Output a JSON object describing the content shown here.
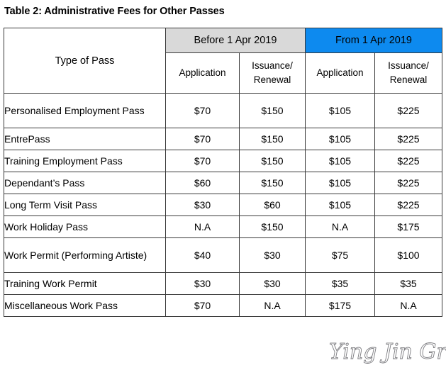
{
  "caption": "Table 2: Administrative Fees for Other Passes",
  "watermark": {
    "text": "Ying Jin Group"
  },
  "table": {
    "header": {
      "type_of_pass": "Type of Pass",
      "groups": [
        {
          "label": "Before 1 Apr 2019",
          "color": "#d9d9d9"
        },
        {
          "label": "From 1 Apr 2019",
          "color": "#0d8aef"
        }
      ],
      "subheaders": [
        "Application",
        "Issuance/ Renewal",
        "Application",
        "Issuance/ Renewal"
      ],
      "subheaders_split": [
        {
          "line1": "Application",
          "line2": ""
        },
        {
          "line1": "Issuance/",
          "line2": "Renewal"
        },
        {
          "line1": "Application",
          "line2": ""
        },
        {
          "line1": "Issuance/",
          "line2": "Renewal"
        }
      ]
    },
    "rows": [
      {
        "pass": "Personalised Employment Pass",
        "before_application": "$70",
        "before_issuance_renewal": "$150",
        "from_application": "$105",
        "from_issuance_renewal": "$225"
      },
      {
        "pass": "EntrePass",
        "before_application": "$70",
        "before_issuance_renewal": "$150",
        "from_application": "$105",
        "from_issuance_renewal": "$225"
      },
      {
        "pass": "Training Employment Pass",
        "before_application": "$70",
        "before_issuance_renewal": "$150",
        "from_application": "$105",
        "from_issuance_renewal": "$225"
      },
      {
        "pass": "Dependant’s Pass",
        "before_application": "$60",
        "before_issuance_renewal": "$150",
        "from_application": "$105",
        "from_issuance_renewal": "$225"
      },
      {
        "pass": "Long Term Visit Pass",
        "before_application": "$30",
        "before_issuance_renewal": "$60",
        "from_application": "$105",
        "from_issuance_renewal": "$225"
      },
      {
        "pass": "Work Holiday Pass",
        "before_application": "N.A",
        "before_issuance_renewal": "$150",
        "from_application": "N.A",
        "from_issuance_renewal": "$175"
      },
      {
        "pass": "Work Permit (Performing Artiste)",
        "before_application": "$40",
        "before_issuance_renewal": "$30",
        "from_application": "$75",
        "from_issuance_renewal": "$100"
      },
      {
        "pass": "Training Work Permit",
        "before_application": "$30",
        "before_issuance_renewal": "$30",
        "from_application": "$35",
        "from_issuance_renewal": "$35"
      },
      {
        "pass": "Miscellaneous Work Pass",
        "before_application": "$70",
        "before_issuance_renewal": "N.A",
        "from_application": "$175",
        "from_issuance_renewal": "N.A"
      }
    ]
  }
}
